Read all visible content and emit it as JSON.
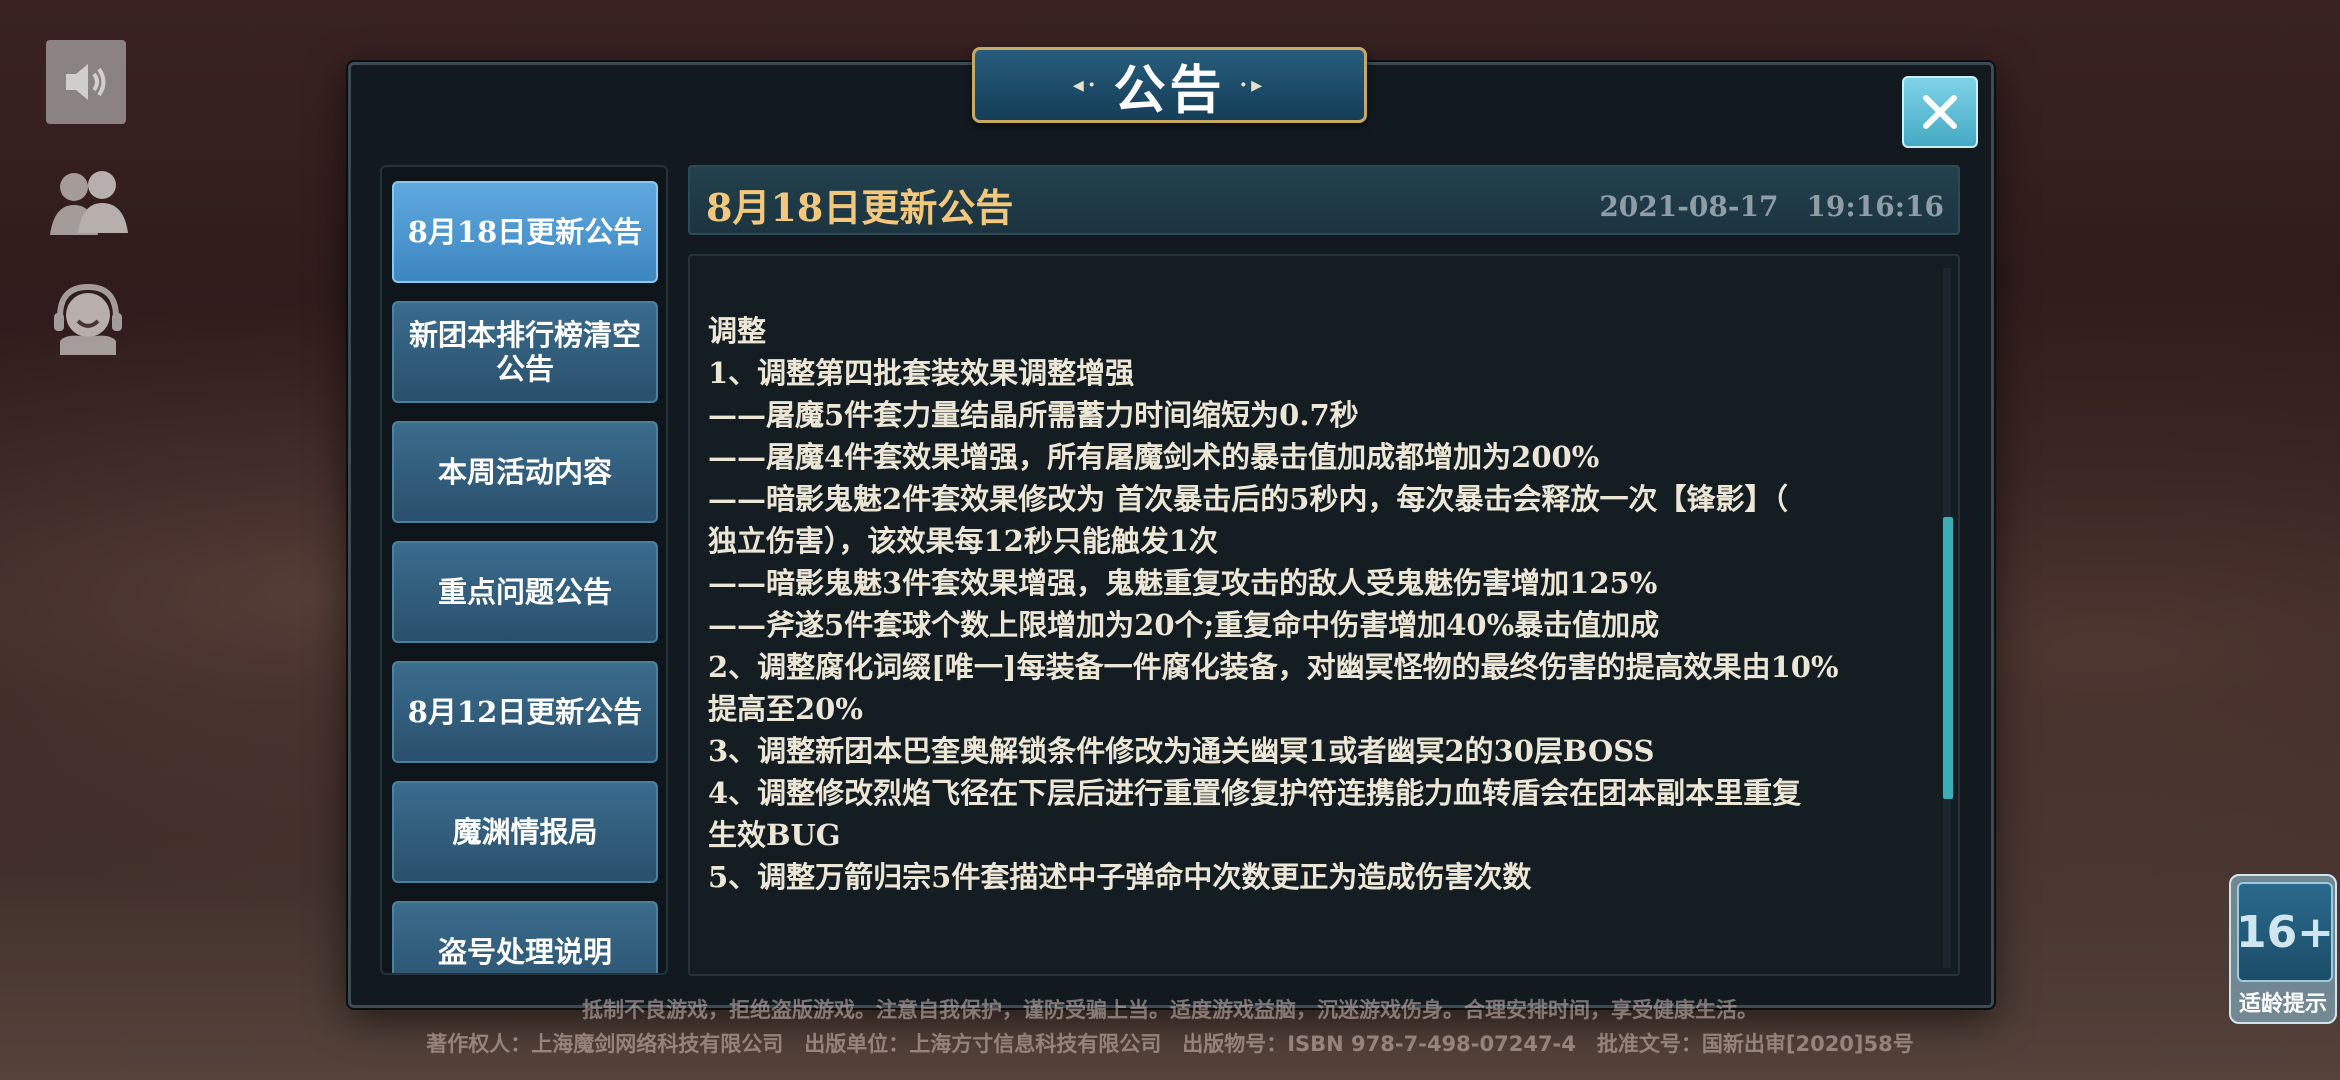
{
  "dialog": {
    "title": "公告",
    "close_icon": "close-icon"
  },
  "side_icons": [
    "speaker-icon",
    "friends-icon",
    "customer-service-icon"
  ],
  "sidebar": {
    "items": [
      {
        "label": "8月18日更新公告",
        "active": true
      },
      {
        "label": "新团本排行榜清空公告",
        "active": false
      },
      {
        "label": "本周活动内容",
        "active": false
      },
      {
        "label": "重点问题公告",
        "active": false
      },
      {
        "label": "8月12日更新公告",
        "active": false
      },
      {
        "label": "魔渊情报局",
        "active": false
      },
      {
        "label": "盗号处理说明",
        "active": false
      }
    ]
  },
  "content": {
    "title": "8月18日更新公告",
    "date": "2021-08-17　19:16:16",
    "lines": [
      "",
      "",
      "调整",
      "1、调整第四批套装效果调整增强",
      "——屠魔5件套力量结晶所需蓄力时间缩短为0.7秒",
      "——屠魔4件套效果增强，所有屠魔剑术的暴击值加成都增加为200%",
      "——暗影鬼魅2件套效果修改为 首次暴击后的5秒内，每次暴击会释放一次【锋影】（",
      "独立伤害），该效果每12秒只能触发1次",
      "——暗影鬼魅3件套效果增强，鬼魅重复攻击的敌人受鬼魅伤害增加125%",
      "——斧遂5件套球个数上限增加为20个;重复命中伤害增加40%暴击值加成",
      "2、调整腐化词缀[唯一]每装备一件腐化装备，对幽冥怪物的最终伤害的提高效果由10%",
      "提高至20%",
      "3、调整新团本巴奎奥解锁条件修改为通关幽冥1或者幽冥2的30层BOSS",
      "4、调整修改烈焰飞径在下层后进行重置修复护符连携能力血转盾会在团本副本里重复",
      "生效BUG",
      "5、调整万箭归宗5件套描述中子弹命中次数更正为造成伤害次数",
      ""
    ]
  },
  "footer": {
    "line1": "抵制不良游戏，拒绝盗版游戏。注意自我保护，谨防受骗上当。适度游戏益脑，沉迷游戏伤身。合理安排时间，享受健康生活。",
    "line2": "著作权人：上海魔剑网络科技有限公司　出版单位：上海方寸信息科技有限公司　出版物号：ISBN 978-7-498-07247-4　批准文号：国新出审[2020]58号"
  },
  "age_rating": {
    "value": "16+",
    "label": "适龄提示"
  }
}
